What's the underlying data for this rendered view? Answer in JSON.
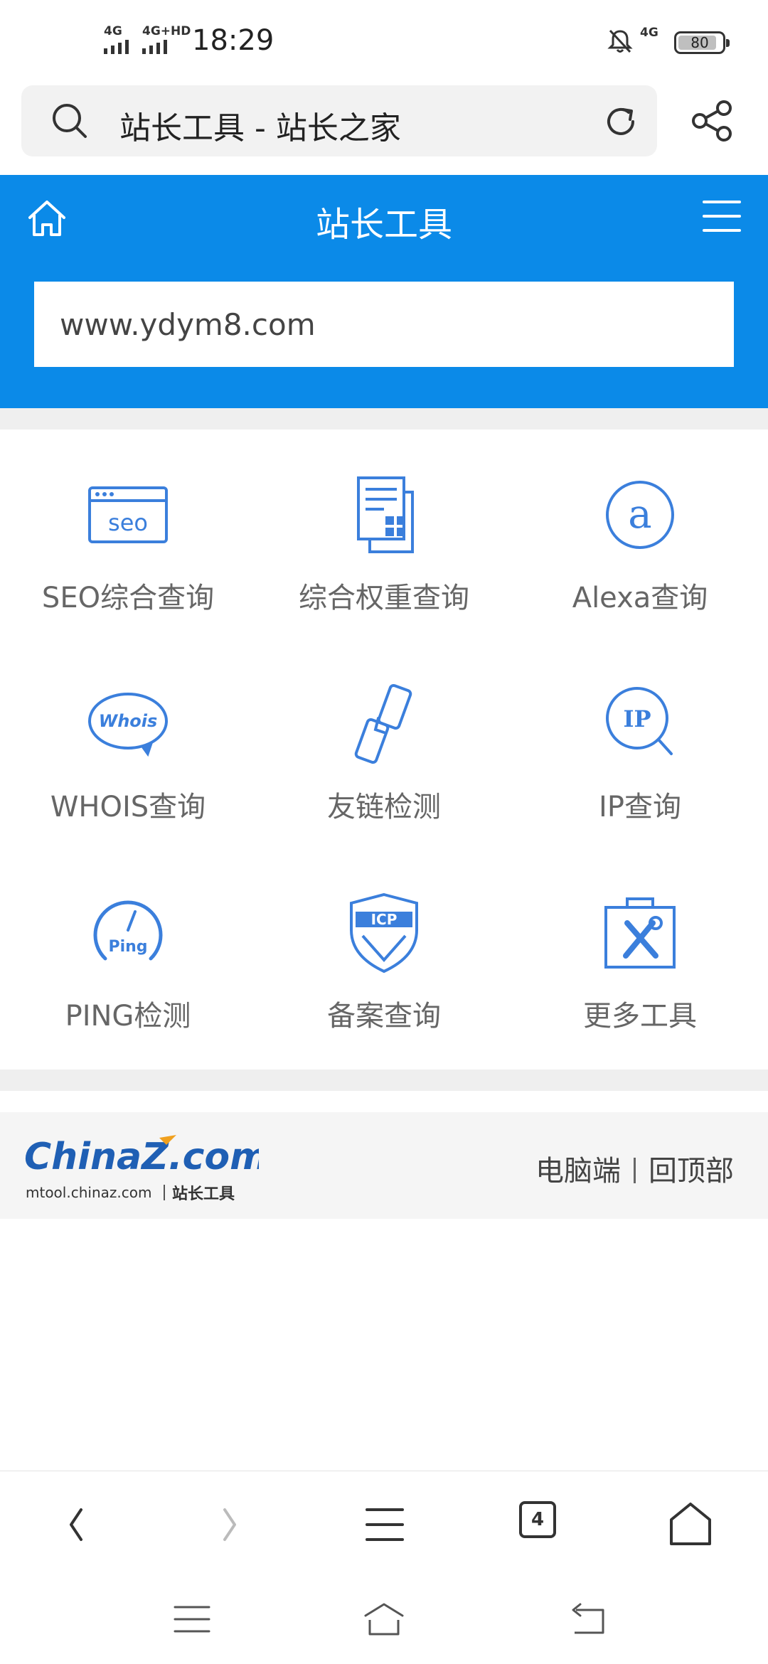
{
  "status_bar": {
    "signal1": "4G",
    "signal2": "4G+HD",
    "time": "18:29",
    "network": "4G",
    "battery": "80"
  },
  "browser": {
    "page_title": "站长工具 - 站长之家"
  },
  "header": {
    "title": "站长工具",
    "input_value": "www.ydym8.com"
  },
  "tools": [
    {
      "label": "SEO综合查询",
      "icon": "seo-icon"
    },
    {
      "label": "综合权重查询",
      "icon": "weight-document-icon"
    },
    {
      "label": "Alexa查询",
      "icon": "alexa-icon"
    },
    {
      "label": "WHOIS查询",
      "icon": "whois-bubble-icon"
    },
    {
      "label": "友链检测",
      "icon": "link-icon"
    },
    {
      "label": "IP查询",
      "icon": "ip-search-icon"
    },
    {
      "label": "PING检测",
      "icon": "ping-gauge-icon"
    },
    {
      "label": "备案查询",
      "icon": "icp-shield-icon"
    },
    {
      "label": "更多工具",
      "icon": "toolbox-icon"
    }
  ],
  "footer": {
    "logo_text": "ChinaZ.com",
    "logo_sub": "mtool.chinaz.com",
    "logo_tag": "站长工具",
    "link_desktop": "电脑端",
    "link_top": "回顶部"
  },
  "browser_nav": {
    "tab_count": "4"
  },
  "colors": {
    "primary_blue": "#0b8ae8",
    "icon_blue": "#3b7fdc",
    "logo_orange": "#f0a01e"
  }
}
